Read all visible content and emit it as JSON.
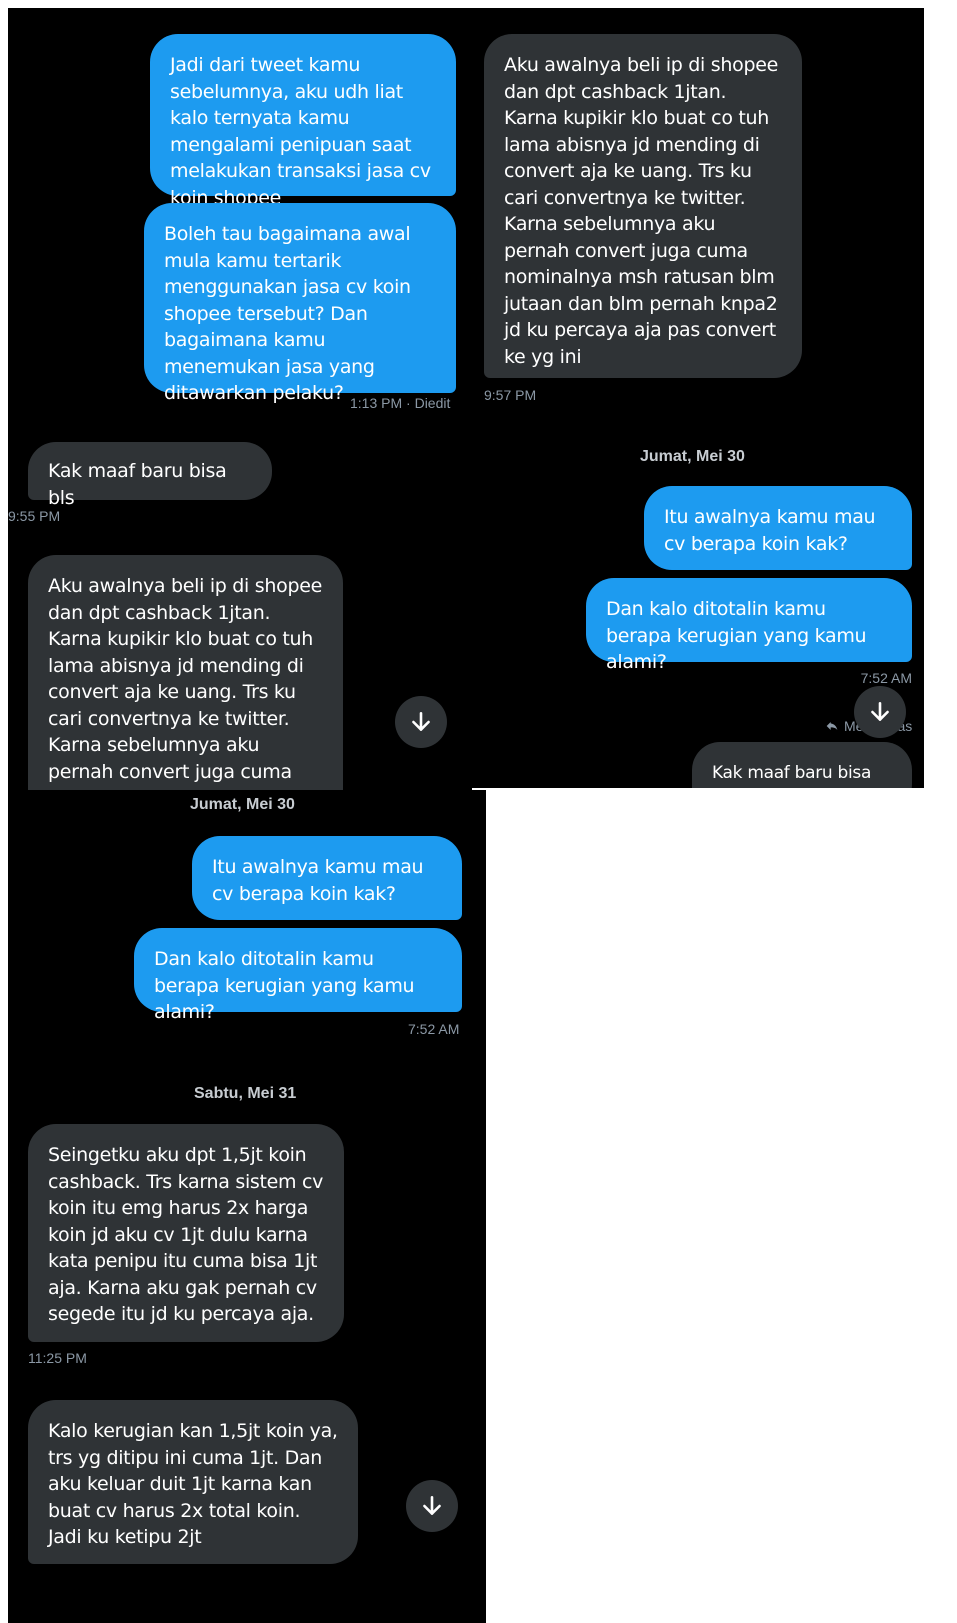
{
  "colors": {
    "background": "#000000",
    "outgoing_bubble": "#1d9bf0",
    "incoming_bubble": "#2f3336",
    "meta_text": "#8b98a5"
  },
  "panel1": {
    "out_msg_1": "Jadi dari tweet kamu sebelumnya, aku udh liat kalo ternyata kamu mengalami penipuan saat melakukan transaksi jasa cv koin shopee",
    "out_msg_2": "Boleh tau bagaimana awal mula kamu tertarik menggunakan jasa cv koin shopee tersebut? Dan bagaimana kamu menemukan jasa yang ditawarkan pelaku?",
    "out_time": "1:13 PM · Diedit",
    "in_msg_1": "Kak maaf baru bisa bls",
    "in_time_1": "9:55 PM",
    "in_msg_2": "Aku awalnya beli ip di shopee dan dpt cashback 1jtan. Karna kupikir klo buat co tuh lama abisnya jd mending di convert aja ke uang. Trs ku cari convertnya ke twitter. Karna sebelumnya aku pernah convert juga cuma nominalnya"
  },
  "panel2": {
    "in_msg_1": "Aku awalnya beli ip di shopee dan dpt cashback 1jtan. Karna kupikir klo buat co tuh lama abisnya jd mending di convert aja ke uang. Trs ku cari convertnya ke twitter. Karna sebelumnya aku pernah convert juga cuma nominalnya msh ratusan blm jutaan dan blm pernah knpa2 jd ku percaya aja pas  convert ke yg ini",
    "in_time": "9:57 PM",
    "day_label": "Jumat, Mei 30",
    "out_msg_1": "Itu awalnya kamu mau cv berapa koin kak?",
    "out_msg_2": "Dan kalo ditotalin kamu berapa kerugian yang kamu alami?",
    "out_time": "7:52 AM",
    "reply_label": "Me",
    "reply_label_tail": "as",
    "partial_msg": "Kak maaf baru bisa bls"
  },
  "panel3": {
    "day_label_1": "Jumat, Mei 30",
    "out_msg_1": "Itu awalnya kamu mau cv berapa koin kak?",
    "out_msg_2": "Dan kalo ditotalin kamu berapa kerugian yang kamu alami?",
    "out_time": "7:52 AM",
    "day_label_2": "Sabtu, Mei 31",
    "in_msg_1": "Seingetku aku dpt 1,5jt koin cashback. Trs karna sistem cv koin itu emg harus 2x harga koin jd aku cv 1jt dulu karna kata penipu itu cuma bisa 1jt aja. Karna aku gak pernah cv segede itu jd ku percaya aja.",
    "in_time": "11:25 PM",
    "in_msg_2": "Kalo kerugian kan 1,5jt koin ya, trs yg ditipu ini cuma 1jt. Dan aku keluar duit 1jt karna kan buat cv harus 2x total koin. Jadi ku ketipu 2jt"
  },
  "icons": {
    "scroll_down": "arrow-down-icon",
    "reply": "reply-arrow-icon"
  }
}
